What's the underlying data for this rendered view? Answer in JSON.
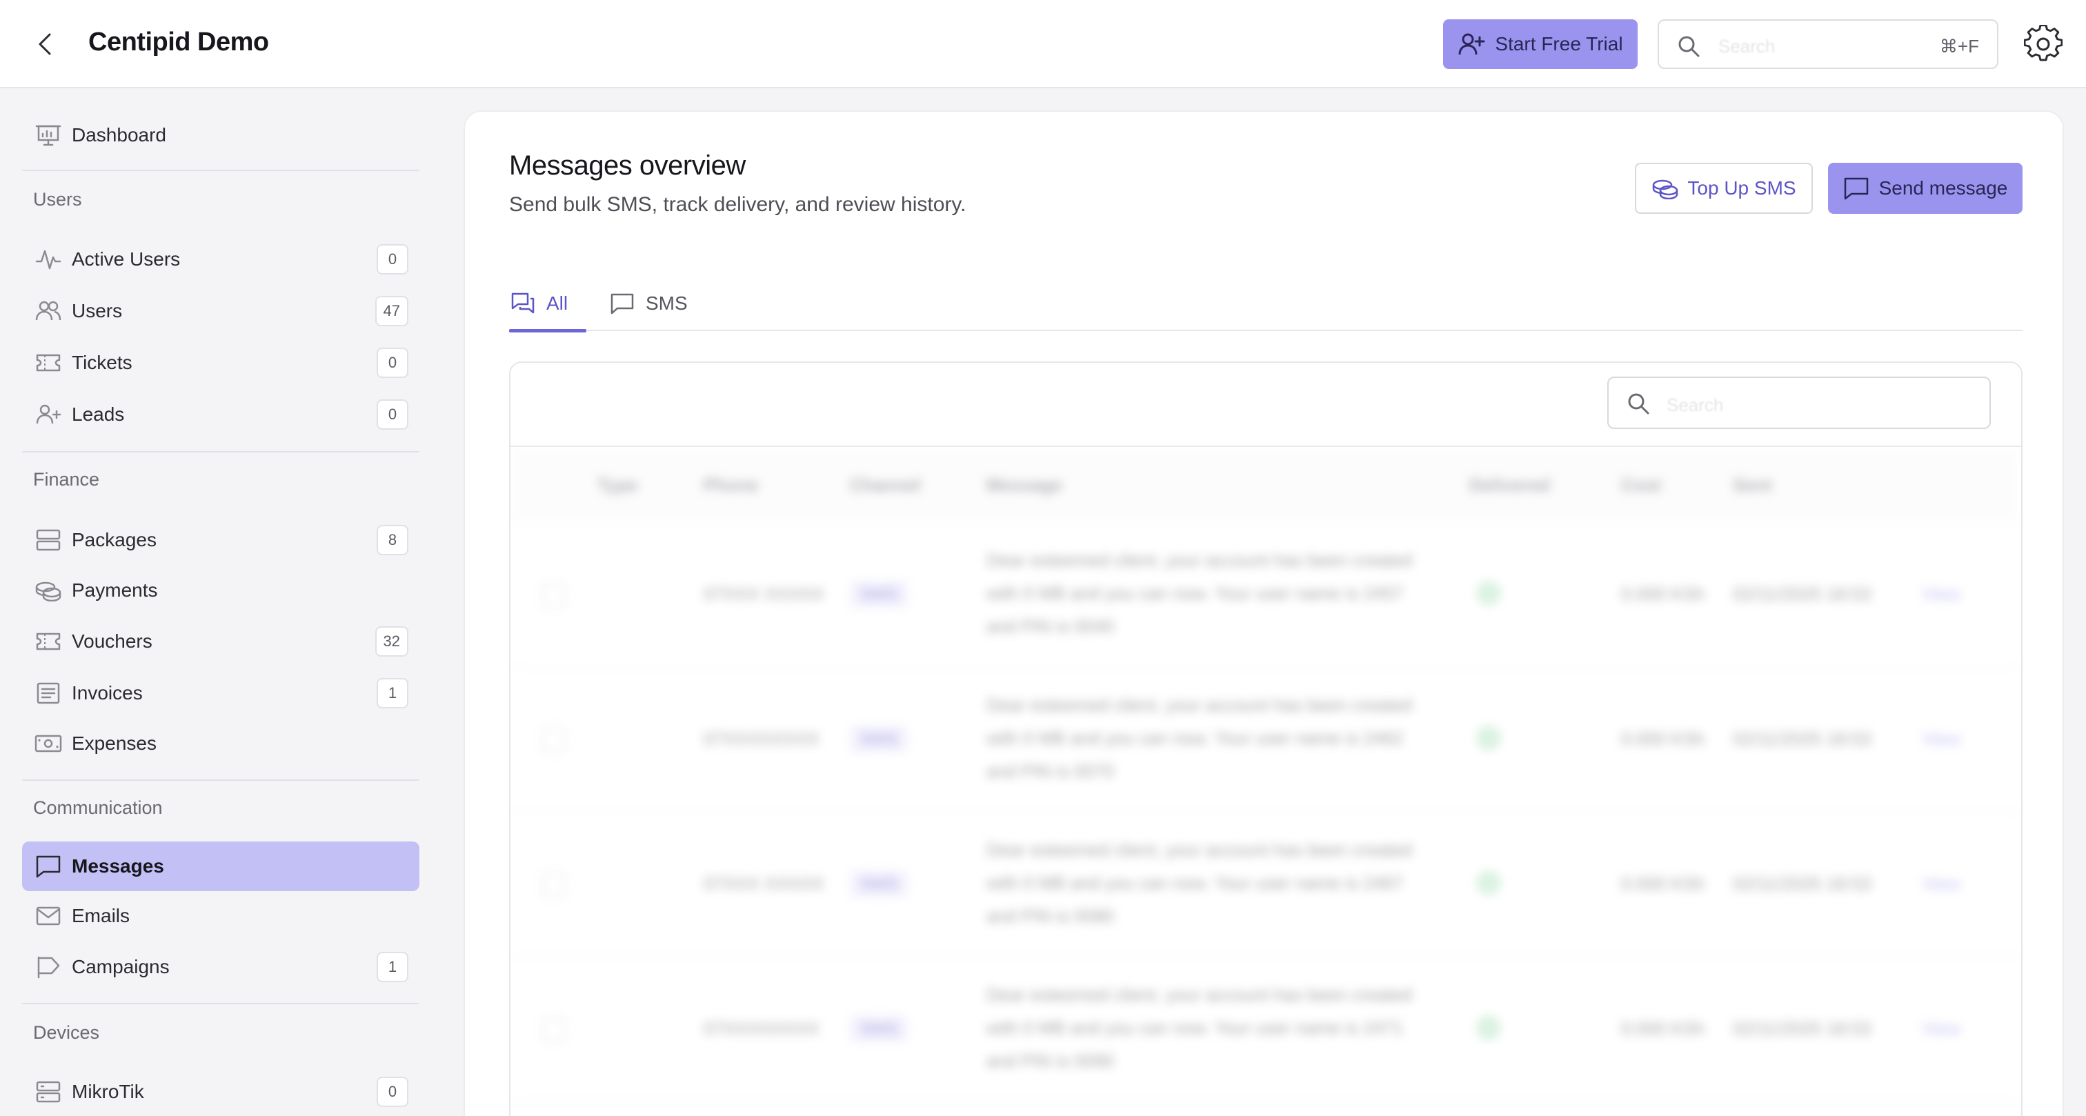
{
  "topbar": {
    "title": "Centipid Demo",
    "trial_label": "Start Free Trial",
    "search_placeholder": "Search",
    "search_shortcut": "⌘+F"
  },
  "sidebar": {
    "dashboard": "Dashboard",
    "sections": {
      "users": "Users",
      "finance": "Finance",
      "communication": "Communication",
      "devices": "Devices"
    },
    "users_items": [
      {
        "label": "Active Users",
        "count": "0"
      },
      {
        "label": "Users",
        "count": "47"
      },
      {
        "label": "Tickets",
        "count": "0"
      },
      {
        "label": "Leads",
        "count": "0"
      }
    ],
    "finance_items": [
      {
        "label": "Packages",
        "count": "8"
      },
      {
        "label": "Payments"
      },
      {
        "label": "Vouchers",
        "count": "32"
      },
      {
        "label": "Invoices",
        "count": "1"
      },
      {
        "label": "Expenses"
      }
    ],
    "communication_items": [
      {
        "label": "Messages",
        "active": true
      },
      {
        "label": "Emails"
      },
      {
        "label": "Campaigns",
        "count": "1"
      }
    ],
    "devices_items": [
      {
        "label": "MikroTik",
        "count": "0"
      }
    ]
  },
  "main": {
    "title": "Messages overview",
    "subtitle": "Send bulk SMS, track delivery, and review history.",
    "topup_label": "Top Up SMS",
    "send_label": "Send message",
    "tabs": [
      {
        "label": "All",
        "active": true
      },
      {
        "label": "SMS",
        "active": false
      }
    ],
    "table_search_placeholder": "Search",
    "columns": [
      "Type",
      "Phone",
      "Channel",
      "Message",
      "Delivered",
      "Cost",
      "Sent"
    ],
    "rows": [
      {
        "phone": "07XXX XXXXX",
        "channel": "SMS",
        "message": "Dear esteemed client, your account has been created with 0 MB and you can now. Your user name is 2457 and PIN is 0040",
        "cost": "0.000 KSh",
        "sent": "02/11/2025 18:53",
        "action": "View"
      },
      {
        "phone": "07XXXXXXXX",
        "channel": "SMS",
        "message": "Dear esteemed client, your account has been created with 0 MB and you can now. Your user name is 2462 and PIN is 0070",
        "cost": "0.000 KSh",
        "sent": "02/11/2025 18:53",
        "action": "View"
      },
      {
        "phone": "07XXX XXXXX",
        "channel": "SMS",
        "message": "Dear esteemed client, your account has been created with 0 MB and you can now. Your user name is 2467 and PIN is 0080",
        "cost": "0.000 KSh",
        "sent": "02/11/2025 18:53",
        "action": "View"
      },
      {
        "phone": "07XXXXXXXX",
        "channel": "SMS",
        "message": "Dear esteemed client, your account has been created with 0 MB and you can now. Your user name is 2471 and PIN is 0090",
        "cost": "0.000 KSh",
        "sent": "02/11/2025 18:53",
        "action": "View"
      }
    ]
  },
  "colors": {
    "accent": "#9b94ee",
    "accent_text": "#5d54c6",
    "active_nav": "#c3c0f6"
  }
}
